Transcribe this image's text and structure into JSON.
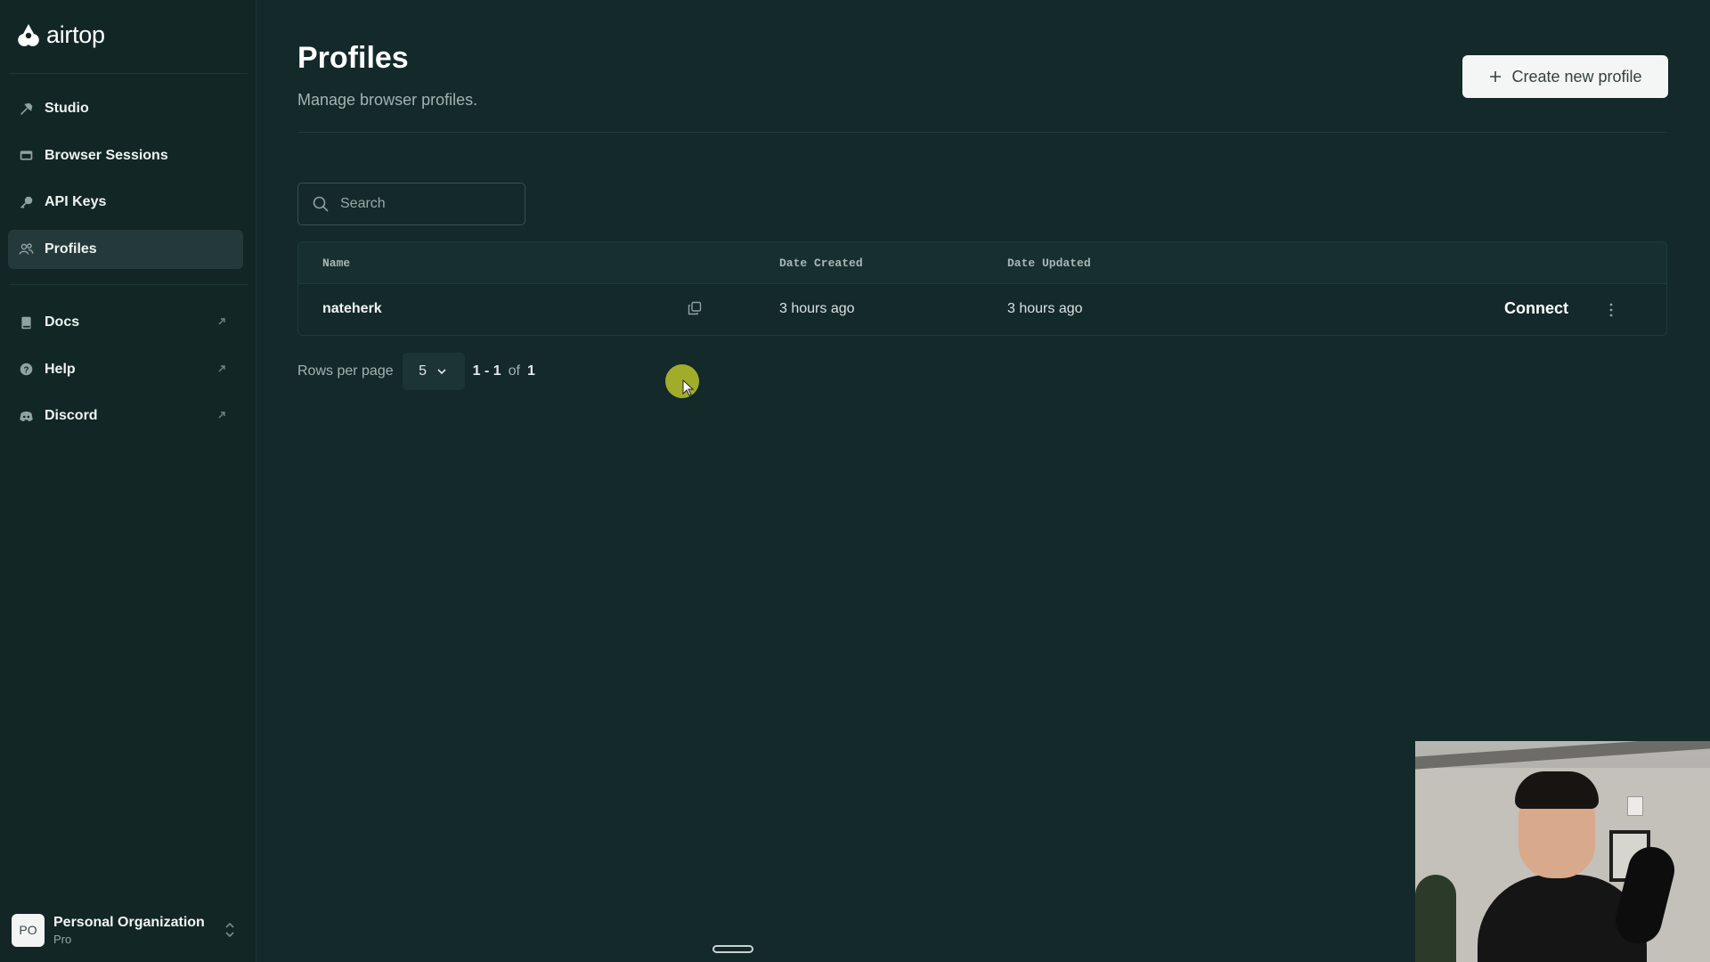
{
  "brand": {
    "name": "airtop"
  },
  "sidebar": {
    "items": [
      {
        "label": "Studio",
        "icon": "hammer-icon",
        "active": false
      },
      {
        "label": "Browser Sessions",
        "icon": "browser-icon",
        "active": false
      },
      {
        "label": "API Keys",
        "icon": "key-icon",
        "active": false
      },
      {
        "label": "Profiles",
        "icon": "users-icon",
        "active": true
      }
    ],
    "external": [
      {
        "label": "Docs",
        "icon": "book-icon"
      },
      {
        "label": "Help",
        "icon": "help-circle-icon"
      },
      {
        "label": "Discord",
        "icon": "discord-icon"
      }
    ],
    "org": {
      "initials": "PO",
      "name": "Personal Organization",
      "plan": "Pro"
    }
  },
  "header": {
    "title": "Profiles",
    "subtitle": "Manage browser profiles.",
    "create_label": "Create new profile"
  },
  "search": {
    "placeholder": "Search",
    "value": ""
  },
  "table": {
    "columns": [
      "Name",
      "Date Created",
      "Date Updated"
    ],
    "rows": [
      {
        "name": "nateherk",
        "created": "3 hours ago",
        "updated": "3 hours ago",
        "action": "Connect"
      }
    ]
  },
  "pagination": {
    "rows_label": "Rows per page",
    "rows_value": "5",
    "range": "1 - 1",
    "of_label": "of",
    "total": "1"
  },
  "colors": {
    "background": "#13292a",
    "sidebar": "#122626",
    "active_item": "#243a3a",
    "button": "#f4f6f5",
    "cursor_highlight": "#a9b42a"
  }
}
